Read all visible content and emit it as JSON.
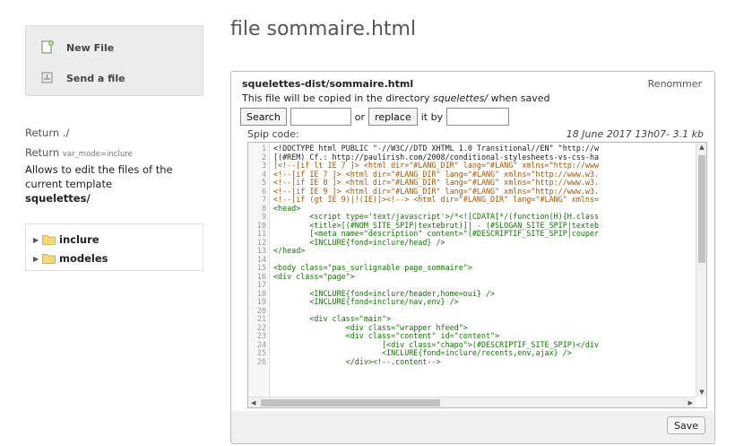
{
  "sidebar": {
    "actions": {
      "new_file": "New File",
      "send_file": "Send a file"
    },
    "return_1": "Return ./",
    "return_2_prefix": "Return",
    "return_2_param": "var_mode=inclure",
    "description": "Allows to edit the files of the current template",
    "template_dir": "squelettes/",
    "tree": [
      {
        "label": "inclure"
      },
      {
        "label": "modeles"
      }
    ]
  },
  "page": {
    "title": "file sommaire.html"
  },
  "panel": {
    "file_path": "squelettes-dist/sommaire.html",
    "rename": "Renommer",
    "copy_note_prefix": "This file will be copied in the directory ",
    "copy_note_dir": "squelettes/",
    "copy_note_suffix": " when saved",
    "search_button": "Search",
    "search_value": "",
    "or_text": "or",
    "replace_button": "replace",
    "by_text": "it by",
    "replace_value": "",
    "code_label": "Spip code:",
    "code_meta": "18 June 2017 13h07- 3.1 kb",
    "save_button": "Save"
  },
  "code_lines": [
    {
      "n": "1",
      "text": "<!DOCTYPE html PUBLIC \"-//W3C//DTD XHTML 1.0 Transitional//EN\" \"http://w",
      "kind": "plain"
    },
    {
      "n": "2",
      "text": "[(#REM) Cf.: http://paulirish.com/2008/conditional-stylesheets-vs-css-ha",
      "kind": "plain"
    },
    {
      "n": "3",
      "text": "]<!--[if lt IE 7 ]> <html dir=\"#LANG_DIR\" lang=\"#LANG\" xmlns=\"http://www",
      "kind": "cmt"
    },
    {
      "n": "4",
      "text": "<!--[if IE 7 ]> <html dir=\"#LANG_DIR\" lang=\"#LANG\" xmlns=\"http://www.w3.",
      "kind": "cmt"
    },
    {
      "n": "5",
      "text": "<!--[if IE 8 ]> <html dir=\"#LANG_DIR\" lang=\"#LANG\" xmlns=\"http://www.w3.",
      "kind": "cmt"
    },
    {
      "n": "6",
      "text": "<!--[if IE 9 ]> <html dir=\"#LANG_DIR\" lang=\"#LANG\" xmlns=\"http://www.w3.",
      "kind": "cmt"
    },
    {
      "n": "7",
      "text": "<!--[if (gt IE 9)|!(IE)]><!--> <html dir=\"#LANG_DIR\" lang=\"#LANG\" xmlns=",
      "kind": "cmt"
    },
    {
      "n": "8",
      "text": "<head>",
      "kind": "tag"
    },
    {
      "n": "9",
      "text": "        <script type='text/javascript'>/*<![CDATA[*/(function(H){H.class",
      "kind": "tag"
    },
    {
      "n": "10",
      "text": "        <title>[(#NOM_SITE_SPIP|textebrut)]| - (#SLOGAN_SITE_SPIP|texteb",
      "kind": "tag"
    },
    {
      "n": "11",
      "text": "        [<meta name=\"description\" content=\"(#DESCRIPTIF_SITE_SPIP|couper",
      "kind": "tag"
    },
    {
      "n": "12",
      "text": "        <INCLURE{fond=inclure/head} />",
      "kind": "tag"
    },
    {
      "n": "13",
      "text": "</head>",
      "kind": "tag"
    },
    {
      "n": "14",
      "text": "",
      "kind": "plain"
    },
    {
      "n": "15",
      "text": "<body class=\"pas_surlignable page_sommaire\">",
      "kind": "tag"
    },
    {
      "n": "16",
      "text": "<div class=\"page\">",
      "kind": "tag"
    },
    {
      "n": "17",
      "text": "",
      "kind": "plain"
    },
    {
      "n": "18",
      "text": "        <INCLURE{fond=inclure/header,home=oui} />",
      "kind": "tag"
    },
    {
      "n": "19",
      "text": "        <INCLURE{fond=inclure/nav,env} />",
      "kind": "tag"
    },
    {
      "n": "20",
      "text": "",
      "kind": "plain"
    },
    {
      "n": "21",
      "text": "        <div class=\"main\">",
      "kind": "tag"
    },
    {
      "n": "22",
      "text": "                <div class=\"wrapper hfeed\">",
      "kind": "tag"
    },
    {
      "n": "23",
      "text": "                <div class=\"content\" id=\"content\">",
      "kind": "tag"
    },
    {
      "n": "24",
      "text": "                        [<div class=\"chapo\">(#DESCRIPTIF_SITE_SPIP)</div",
      "kind": "tag"
    },
    {
      "n": "25",
      "text": "                        <INCLURE{fond=inclure/recents,env,ajax} />",
      "kind": "tag"
    },
    {
      "n": "26",
      "text": "                </div><!--.content-->",
      "kind": "tag"
    }
  ],
  "colors": {
    "tag": "#117700",
    "comment": "#aa5500",
    "attr": "#0000cc",
    "string": "#aa1111"
  }
}
